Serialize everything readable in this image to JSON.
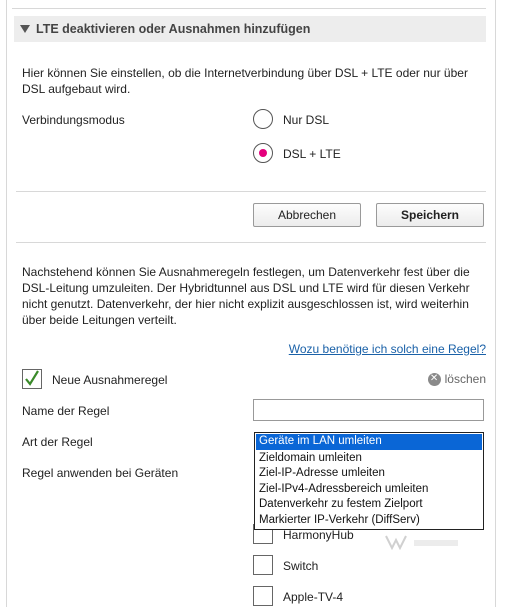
{
  "section": {
    "title": "LTE deaktivieren oder Ausnahmen hinzufügen"
  },
  "intro": "Hier können Sie einstellen, ob die Internetverbindung über DSL + LTE oder nur über DSL aufgebaut wird.",
  "mode": {
    "label": "Verbindungsmodus",
    "options": [
      {
        "label": "Nur DSL",
        "selected": false
      },
      {
        "label": "DSL + LTE",
        "selected": true
      }
    ]
  },
  "buttons": {
    "cancel": "Abbrechen",
    "save": "Speichern"
  },
  "exceptions_text": "Nachstehend können Sie Ausnahmeregeln festlegen, um Datenverkehr fest über die DSL-Leitung umzuleiten. Der Hybridtunnel aus DSL und LTE wird für diesen Verkehr nicht genutzt. Datenverkehr, der hier nicht explizit ausgeschlossen ist, wird weiterhin über beide Leitungen verteilt.",
  "help_link": "Wozu benötige ich solch eine Regel?",
  "new_rule": {
    "label": "Neue Ausnahmeregel",
    "checked": true,
    "delete_label": "löschen",
    "name_label": "Name der Regel",
    "name_value": "",
    "type_label": "Art der Regel",
    "apply_label": "Regel anwenden bei Geräten",
    "type_options": [
      "Geräte im LAN umleiten",
      "Zieldomain umleiten",
      "Ziel-IP-Adresse umleiten",
      "Ziel-IPv4-Adressbereich umleiten",
      "Datenverkehr zu festem Zielport",
      "Markierter IP-Verkehr (DiffServ)"
    ],
    "selected_type": "Geräte im LAN umleiten"
  },
  "devices": [
    "HarmonyHub",
    "Switch",
    "Apple-TV-4"
  ],
  "colors": {
    "accent": "#e4007c",
    "check": "#3a8a2a",
    "selection": "#0a66d6",
    "link": "#1a61a8"
  }
}
